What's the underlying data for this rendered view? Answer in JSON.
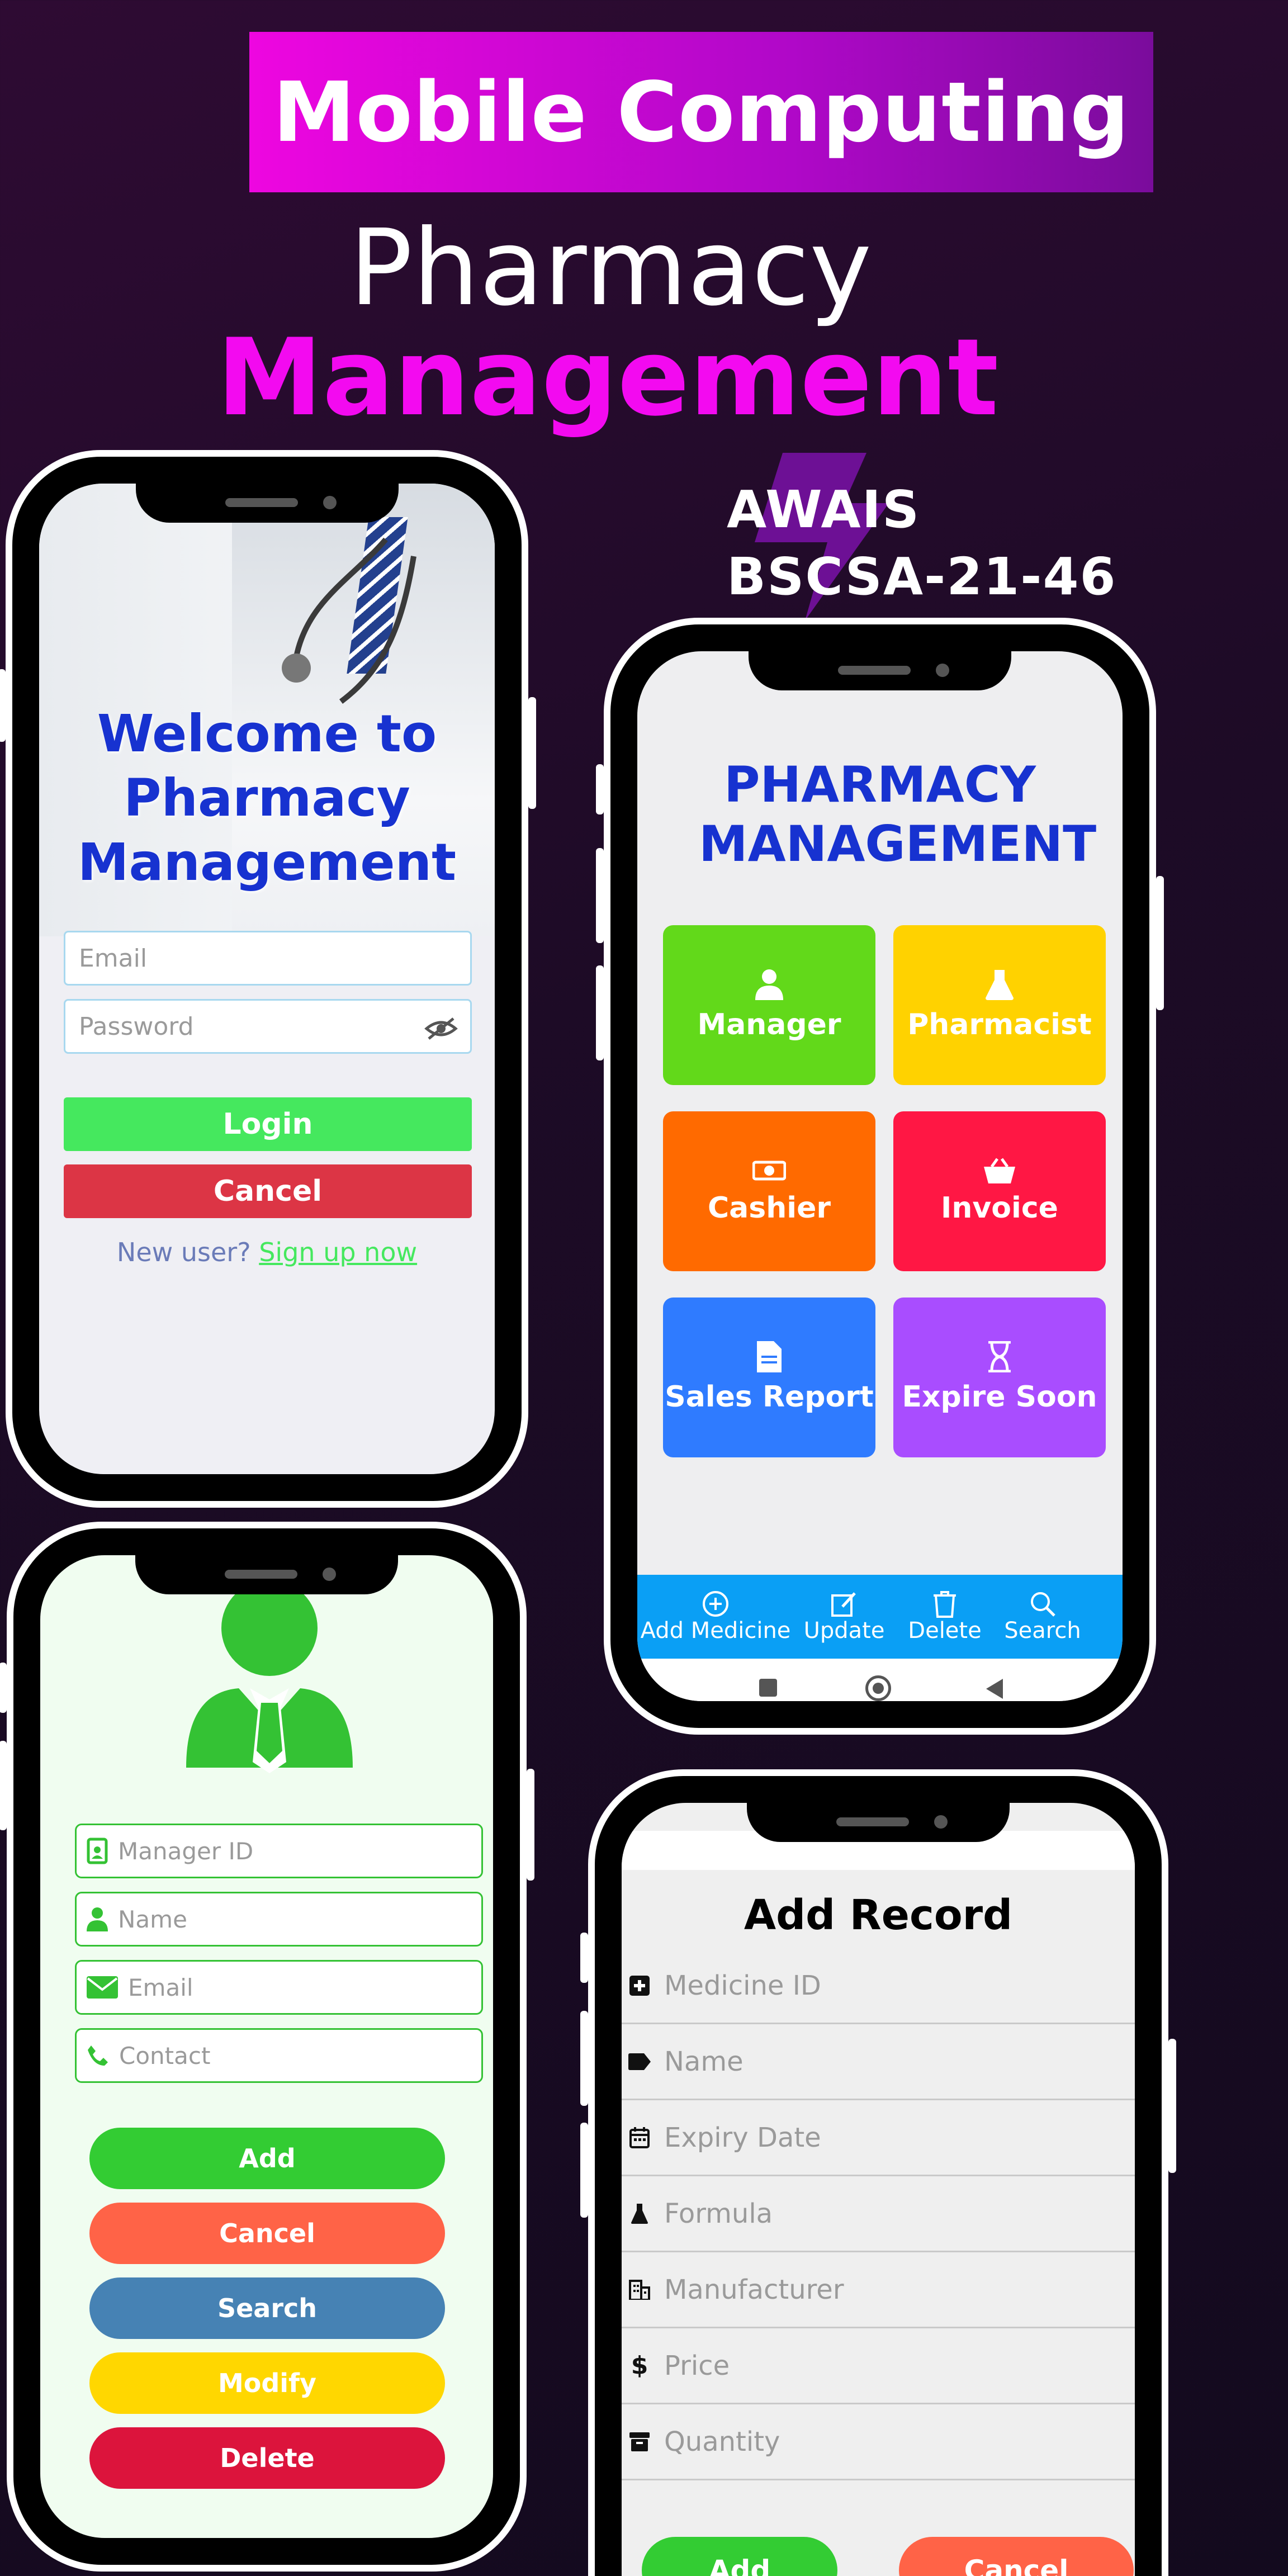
{
  "header": {
    "banner": "Mobile Computing",
    "title_line1": "Pharmacy",
    "title_line2": "Management",
    "author_name": "AWAIS",
    "author_id": "BSCSA-21-46"
  },
  "colors": {
    "banner_pink": "#ee06e0",
    "accent_magenta": "#f30af0",
    "title_blue": "#1732d0",
    "green": "#33cc33",
    "orange": "#ff6347",
    "steel_blue": "#4682b4",
    "gold": "#ffd700",
    "crimson": "#dc143c"
  },
  "login_screen": {
    "welcome": "Welcome to Pharmacy Management",
    "email_placeholder": "Email",
    "password_placeholder": "Password",
    "login_label": "Login",
    "cancel_label": "Cancel",
    "new_user_text": "New user?",
    "signup_link": "Sign up now"
  },
  "dashboard": {
    "title": "PHARMACY MANAGEMENT",
    "tiles": [
      {
        "label": "Manager",
        "icon": "user-icon",
        "color": "#62d91a"
      },
      {
        "label": "Pharmacist",
        "icon": "flask-icon",
        "color": "#ffd200"
      },
      {
        "label": "Cashier",
        "icon": "money-icon",
        "color": "#ff6a00"
      },
      {
        "label": "Invoice",
        "icon": "basket-icon",
        "color": "#ff1744"
      },
      {
        "label": "Sales Report",
        "icon": "document-icon",
        "color": "#2f7bff"
      },
      {
        "label": "Expire Soon",
        "icon": "hourglass-icon",
        "color": "#a94dff"
      }
    ],
    "bottom_nav": [
      {
        "label": "Add Medicine",
        "icon": "plus-circle-icon"
      },
      {
        "label": "Update",
        "icon": "edit-icon"
      },
      {
        "label": "Delete",
        "icon": "trash-icon"
      },
      {
        "label": "Search",
        "icon": "search-icon"
      }
    ]
  },
  "manager_form": {
    "fields": [
      {
        "placeholder": "Manager ID",
        "icon": "id-badge-icon"
      },
      {
        "placeholder": "Name",
        "icon": "user-icon"
      },
      {
        "placeholder": "Email",
        "icon": "envelope-icon"
      },
      {
        "placeholder": "Contact",
        "icon": "phone-icon"
      }
    ],
    "buttons": [
      {
        "label": "Add",
        "color": "#33cc33"
      },
      {
        "label": "Cancel",
        "color": "#ff6347"
      },
      {
        "label": "Search",
        "color": "#4682b4"
      },
      {
        "label": "Modify",
        "color": "#ffd700"
      },
      {
        "label": "Delete",
        "color": "#dc143c"
      }
    ]
  },
  "add_record": {
    "title": "Add Record",
    "fields": [
      {
        "placeholder": "Medicine ID",
        "icon": "plus-square-icon"
      },
      {
        "placeholder": "Name",
        "icon": "tag-icon"
      },
      {
        "placeholder": "Expiry Date",
        "icon": "calendar-icon"
      },
      {
        "placeholder": "Formula",
        "icon": "flask-icon"
      },
      {
        "placeholder": "Manufacturer",
        "icon": "building-icon"
      },
      {
        "placeholder": "Price",
        "icon": "dollar-icon"
      },
      {
        "placeholder": "Quantity",
        "icon": "archive-icon"
      }
    ],
    "add_label": "Add",
    "cancel_label": "Cancel"
  }
}
